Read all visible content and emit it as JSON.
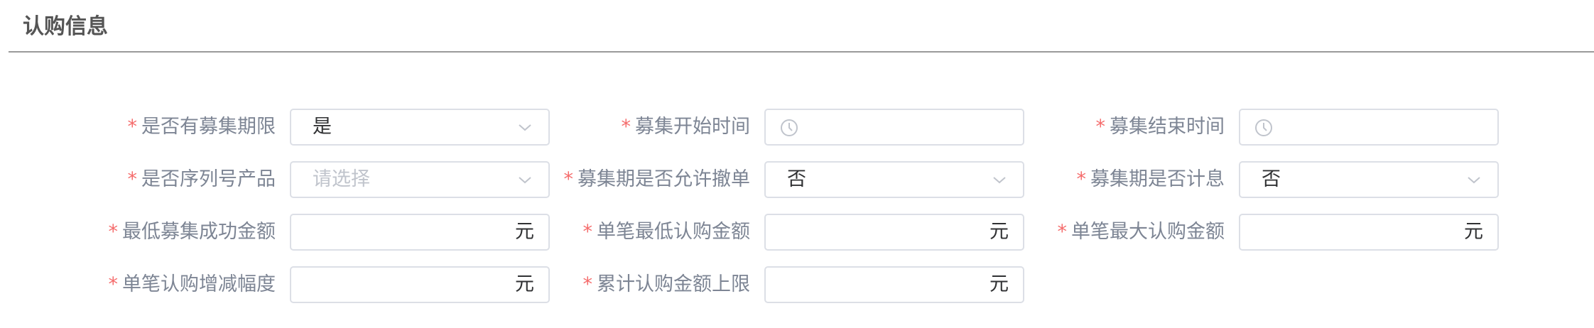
{
  "section": {
    "title": "认购信息"
  },
  "fields": {
    "has_period": {
      "label": "是否有募集期限",
      "value": "是",
      "icon": "chevron-down-icon"
    },
    "start_time": {
      "label": "募集开始时间",
      "value": "",
      "icon": "clock-icon"
    },
    "end_time": {
      "label": "募集结束时间",
      "value": "",
      "icon": "clock-icon"
    },
    "serial_product": {
      "label": "是否序列号产品",
      "placeholder": "请选择",
      "icon": "chevron-down-icon"
    },
    "allow_cancel": {
      "label": "募集期是否允许撤单",
      "value": "否",
      "icon": "chevron-down-icon"
    },
    "accrue_interest": {
      "label": "募集期是否计息",
      "value": "否",
      "icon": "chevron-down-icon"
    },
    "min_success_amount": {
      "label": "最低募集成功金额",
      "value": "",
      "unit": "元"
    },
    "single_min_amount": {
      "label": "单笔最低认购金额",
      "value": "",
      "unit": "元"
    },
    "single_max_amount": {
      "label": "单笔最大认购金额",
      "value": "",
      "unit": "元"
    },
    "single_step": {
      "label": "单笔认购增减幅度",
      "value": "",
      "unit": "元"
    },
    "total_limit": {
      "label": "累计认购金额上限",
      "value": "",
      "unit": "元"
    }
  },
  "required_mark": "*",
  "colors": {
    "required": "#f56c6c",
    "label": "#7d8594",
    "border": "#dcdfe6",
    "text": "#303133",
    "placeholder": "#c0c4cc",
    "divider": "#9a9a9a"
  }
}
